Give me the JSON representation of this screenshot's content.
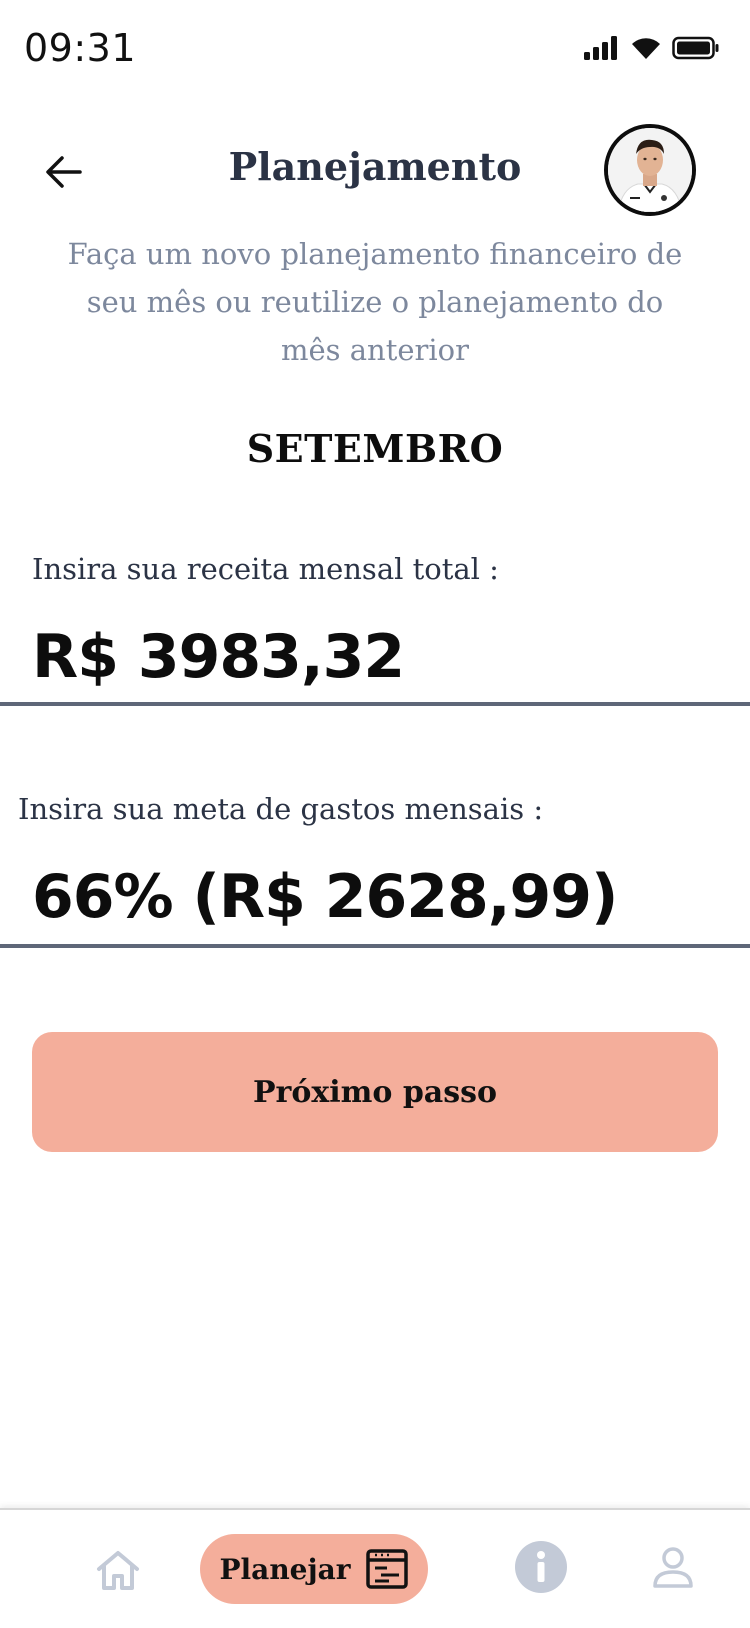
{
  "status_bar": {
    "time": "09:31"
  },
  "header": {
    "title": "Planejamento",
    "back_icon": "arrow-left-icon",
    "avatar_icon": "user-avatar"
  },
  "subtitle": "Faça um novo planejamento financeiro de seu mês ou reutilize o planejamento do mês anterior",
  "month": "SETEMBRO",
  "income_field": {
    "label": "Insira sua receita mensal total :",
    "value": "R$ 3983,32"
  },
  "goal_field": {
    "label": "Insira sua meta de gastos mensais :",
    "value": "66% (R$ 2628,99)"
  },
  "next_button": {
    "label": "Próximo passo"
  },
  "bottom_nav": {
    "items": [
      {
        "id": "home",
        "icon": "home-icon"
      },
      {
        "id": "plan",
        "label": "Planejar",
        "icon": "planner-icon",
        "active": true
      },
      {
        "id": "info",
        "icon": "info-icon"
      },
      {
        "id": "profile",
        "icon": "profile-icon"
      }
    ]
  },
  "colors": {
    "accent": "#f4ae9b",
    "title": "#2b3345",
    "subtitle": "#7d889d",
    "underline": "#5e6778",
    "inactive_icon": "#c3cad7"
  }
}
